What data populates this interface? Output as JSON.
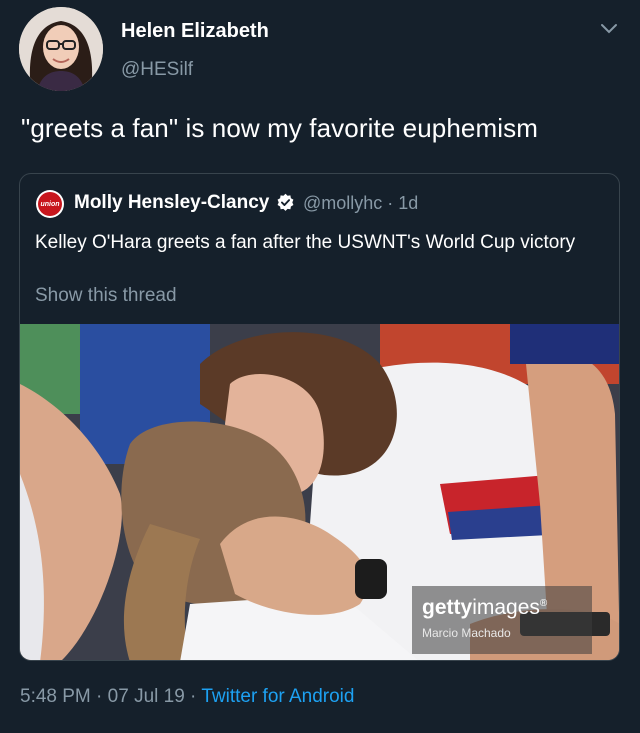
{
  "author": {
    "name": "Helen Elizabeth",
    "handle": "@HESilf",
    "avatar_icon": "profile-photo"
  },
  "tweet": {
    "text": "\"greets a fan\" is now my favorite euphemism"
  },
  "quoted_tweet": {
    "author_name": "Molly Hensley-Clancy",
    "verified": true,
    "handle_time": "@mollyhc · 1d",
    "avatar_text": "union",
    "text": "Kelley O'Hara greets a fan after the USWNT's World Cup victory",
    "show_thread": "Show this thread",
    "photo": {
      "watermark_brand_bold": "getty",
      "watermark_brand_rest": "images",
      "watermark_reg": "®",
      "watermark_credit": "Marcio Machado"
    }
  },
  "meta": {
    "time": "5:48 PM",
    "sep1": " · ",
    "date": "07 Jul 19",
    "sep2": " · ",
    "client": "Twitter for Android"
  },
  "colors": {
    "background": "#15202b",
    "text": "#ffffff",
    "secondary": "#8899a6",
    "link": "#1da1f2",
    "verified": "#ffffff"
  }
}
